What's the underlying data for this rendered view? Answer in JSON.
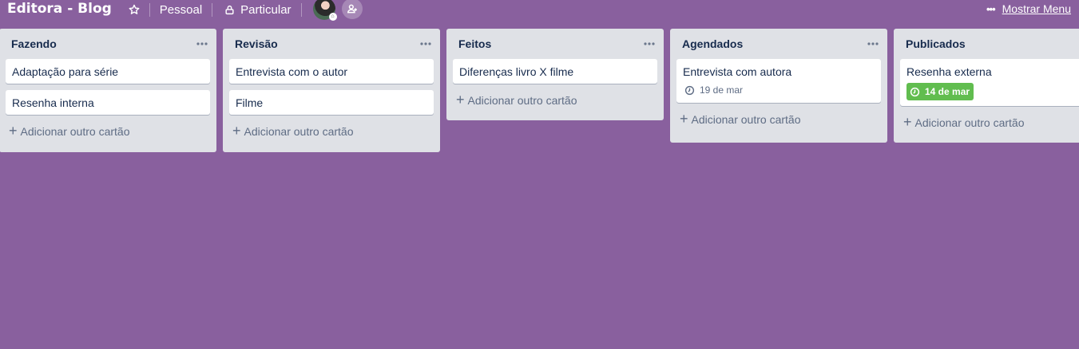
{
  "board": {
    "title": "Editora - Blog",
    "team": "Pessoal",
    "visibility": "Particular",
    "menu_label": "Mostrar Menu"
  },
  "colors": {
    "background": "#89609e",
    "list_bg": "#dfe1e6",
    "due_done": "#61bd4f"
  },
  "lists": [
    {
      "title": "Fazendo",
      "cards": [
        {
          "text": "Adaptação para série"
        },
        {
          "text": "Resenha interna"
        }
      ],
      "add_label": "Adicionar outro cartão"
    },
    {
      "title": "Revisão",
      "cards": [
        {
          "text": "Entrevista com o autor"
        },
        {
          "text": "Filme"
        }
      ],
      "add_label": "Adicionar outro cartão"
    },
    {
      "title": "Feitos",
      "cards": [
        {
          "text": "Diferenças livro X filme"
        }
      ],
      "add_label": "Adicionar outro cartão"
    },
    {
      "title": "Agendados",
      "cards": [
        {
          "text": "Entrevista com autora",
          "due": "19 de mar",
          "due_status": "pending"
        }
      ],
      "add_label": "Adicionar outro cartão"
    },
    {
      "title": "Publicados",
      "cards": [
        {
          "text": "Resenha externa",
          "due": "14 de mar",
          "due_status": "complete"
        }
      ],
      "add_label": "Adicionar outro cartão"
    }
  ]
}
